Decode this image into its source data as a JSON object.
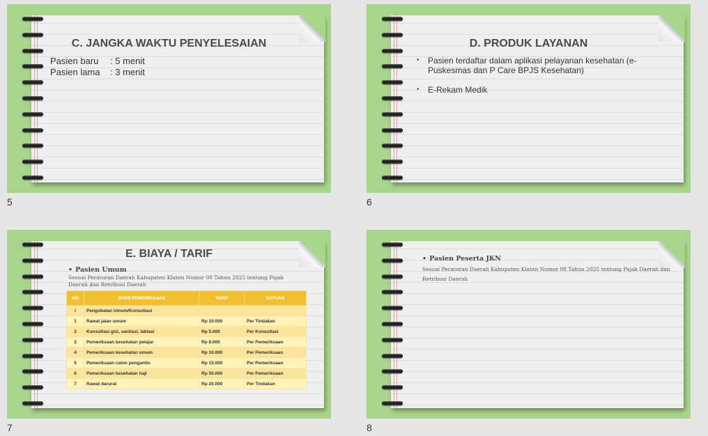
{
  "slides": [
    {
      "number": "5",
      "title": "C. JANGKA WAKTU PENYELESAIAN",
      "rows": [
        {
          "label": "Pasien baru",
          "value": ": 5 menit"
        },
        {
          "label": "Pasien lama",
          "value": ": 3 menit"
        }
      ]
    },
    {
      "number": "6",
      "title": "D. PRODUK LAYANAN",
      "bullets": [
        "Pasien terdaftar dalam aplikasi pelayanan kesehatan (e-Puskesmas dan P Care BPJS Kesehatan)",
        "E-Rekam Medik"
      ]
    },
    {
      "number": "7",
      "title": "E. BIAYA / TARIF",
      "heading": "Pasien Umum",
      "subtext": "Sesuai Peraturan Daerah Kabupaten Klaten Nomor 08 Tahun 2025 tentang Pajak Daerah dan Retribusi Daerah",
      "table": {
        "headers": [
          "NO",
          "JENIS PEMERIKSAAN",
          "TARIF",
          "SATUAN"
        ],
        "rows": [
          {
            "no": "I",
            "jenis": "Pengobatan Umum/Konsultasi",
            "tarif": "",
            "satuan": ""
          },
          {
            "no": "1",
            "jenis": "Rawat jalan umum",
            "tarif": "Rp   10.000",
            "satuan": "Per Tindakan"
          },
          {
            "no": "2",
            "jenis": "Konsultasi gizi, sanitasi, laktasi",
            "tarif": "Rp     5.000",
            "satuan": "Per Konsultasi"
          },
          {
            "no": "3",
            "jenis": "Pemeriksaan kesehatan pelajar",
            "tarif": "Rp     8.000",
            "satuan": "Per Pemeriksaan"
          },
          {
            "no": "4",
            "jenis": "Pemeriksaan kesehatan umum",
            "tarif": "Rp   10.000",
            "satuan": "Per Pemeriksaan"
          },
          {
            "no": "5",
            "jenis": "Pemeriksaan calon pengantin",
            "tarif": "Rp   15.000",
            "satuan": "Per Pemeriksaan"
          },
          {
            "no": "6",
            "jenis": "Pemeriksaan kesehatan haji",
            "tarif": "Rp   50.000",
            "satuan": "Per Pemeriksaan"
          },
          {
            "no": "7",
            "jenis": "Rawat darurat",
            "tarif": "Rp   20.000",
            "satuan": "Per Tindakan"
          }
        ]
      }
    },
    {
      "number": "8",
      "heading": "Pasien Peserta JKN",
      "subtext": "Sesuai Peraturan Daerah Kabupaten Klaten Nomor 08 Tahun 2025 tentang Pajak Daerah dan Retribusi Daerah"
    }
  ],
  "colors": {
    "slide_background": "#a8d58c",
    "paper": "#efefef",
    "table_header": "#f0c030",
    "table_row_dark": "#fbe49b",
    "table_row_light": "#fff3b8"
  },
  "icons": [
    "spiral-binding-icon",
    "page-curl-icon",
    "bullet-icon"
  ]
}
